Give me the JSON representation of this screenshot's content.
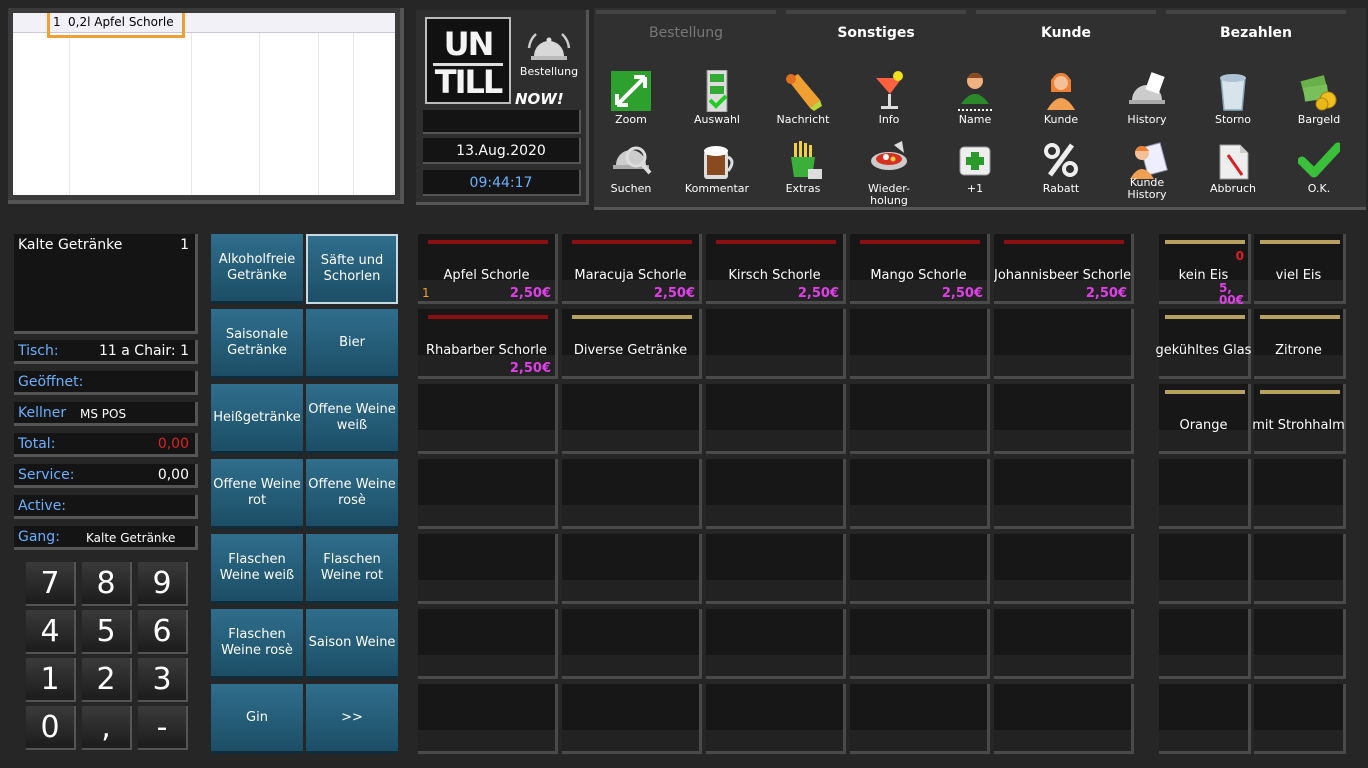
{
  "order": {
    "items": [
      {
        "qty": "1",
        "name": "0,2l Apfel Schorle"
      }
    ]
  },
  "logo": {
    "top": "UN",
    "bottom": "TILL",
    "tagline": "NOW!"
  },
  "bell_label": "Bestellung",
  "date": "13.Aug.2020",
  "time": "09:44:17",
  "tabs": [
    "Bestellung",
    "Sonstiges",
    "Kunde",
    "Bezahlen"
  ],
  "tools_row1": [
    {
      "label": "Zoom",
      "icon": "zoom-icon"
    },
    {
      "label": "Auswahl",
      "icon": "auswahl-icon"
    },
    {
      "label": "Nachricht",
      "icon": "nachricht-icon"
    },
    {
      "label": "Info",
      "icon": "info-icon"
    },
    {
      "label": "Name",
      "icon": "name-icon"
    },
    {
      "label": "Kunde",
      "icon": "kunde-icon"
    },
    {
      "label": "History",
      "icon": "history-icon"
    },
    {
      "label": "Storno",
      "icon": "storno-icon"
    },
    {
      "label": "Bargeld",
      "icon": "bargeld-icon"
    }
  ],
  "tools_row2": [
    {
      "label": "Suchen",
      "icon": "suchen-icon"
    },
    {
      "label": "Kommentar",
      "icon": "kommentar-icon"
    },
    {
      "label": "Extras",
      "icon": "extras-icon"
    },
    {
      "label": "Wieder-",
      "label2": "holung",
      "icon": "wiederholung-icon"
    },
    {
      "label": "+1",
      "icon": "plus-one-icon"
    },
    {
      "label": "Rabatt",
      "icon": "rabatt-icon"
    },
    {
      "label": "Kunde",
      "label2": "History",
      "icon": "kunde-history-icon"
    },
    {
      "label": "Abbruch",
      "icon": "abbruch-icon"
    },
    {
      "label": "O.K.",
      "icon": "ok-icon"
    }
  ],
  "info": {
    "category": "Kalte Getränke",
    "category_count": "1",
    "tisch_label": "Tisch:",
    "tisch_value": "11 a Chair: 1",
    "geoeffnet_label": "Geöffnet:",
    "kellner_label": "Kellner",
    "kellner_value": "MS POS",
    "total_label": "Total:",
    "total_value": "0,00",
    "service_label": "Service:",
    "service_value": "0,00",
    "active_label": "Active:",
    "gang_label": "Gang:",
    "gang_value": "Kalte Getränke"
  },
  "keypad": [
    "7",
    "8",
    "9",
    "4",
    "5",
    "6",
    "1",
    "2",
    "3",
    "0",
    ",",
    "-"
  ],
  "categories": [
    "Alkoholfreie Getränke",
    "Säfte und Schorlen",
    "Saisonale Getränke",
    "Bier",
    "Heißgetränke",
    "Offene Weine weiß",
    "Offene Weine rot",
    "Offene Weine rosè",
    "Flaschen Weine weiß",
    "Flaschen Weine rot",
    "Flaschen Weine rosè",
    "Saison Weine",
    "Gin",
    ">>"
  ],
  "products": [
    {
      "name": "Apfel Schorle",
      "price": "2,50€",
      "qty": "1",
      "accent": "#8a1010"
    },
    {
      "name": "Maracuja Schorle",
      "price": "2,50€",
      "qty": "",
      "accent": "#8a1010"
    },
    {
      "name": "Kirsch Schorle",
      "price": "2,50€",
      "qty": "",
      "accent": "#8a1010"
    },
    {
      "name": "Mango Schorle",
      "price": "2,50€",
      "qty": "",
      "accent": "#8a1010"
    },
    {
      "name": "Johannisbeer Schorle",
      "price": "2,50€",
      "qty": "",
      "accent": "#8a1010"
    },
    {
      "name": "Rhabarber Schorle",
      "price": "2,50€",
      "qty": "",
      "accent": "#8a1010"
    },
    {
      "name": "Diverse Getränke",
      "price": "",
      "qty": "",
      "accent": "#b8a060"
    }
  ],
  "extras": [
    {
      "name": "kein Eis",
      "red": "0",
      "mag1": "5,",
      "mag2": "00€"
    },
    {
      "name": "viel Eis",
      "red": "",
      "mag1": "",
      "mag2": ""
    },
    {
      "name": "gekühltes Glas",
      "red": "",
      "mag1": "",
      "mag2": ""
    },
    {
      "name": "Zitrone",
      "red": "",
      "mag1": "",
      "mag2": ""
    },
    {
      "name": "Orange",
      "red": "",
      "mag1": "",
      "mag2": ""
    },
    {
      "name": "mit Strohhalm",
      "red": "",
      "mag1": "",
      "mag2": ""
    }
  ],
  "colors": {
    "accent_blue": "#6ab0ff",
    "price_magenta": "#e040e8",
    "total_red": "#e02020",
    "selection_orange": "#f0a030",
    "category_blue": "#2f6e8c"
  }
}
